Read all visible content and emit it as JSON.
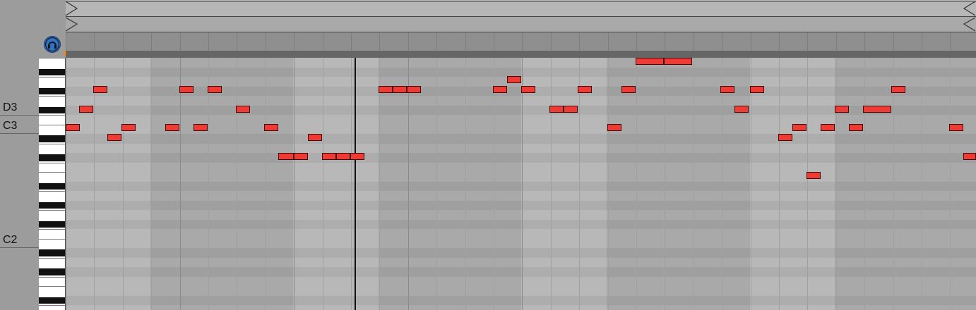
{
  "piano_roll": {
    "pitch_labels": [
      "D3",
      "C3",
      "C2"
    ],
    "note_color": "#ef3b34",
    "grid_background": "#b7b7b7",
    "accent_button_color": "#2f73c6",
    "fold_marker_color": "#f08a1c",
    "icons": [
      "headphone-icon"
    ]
  }
}
